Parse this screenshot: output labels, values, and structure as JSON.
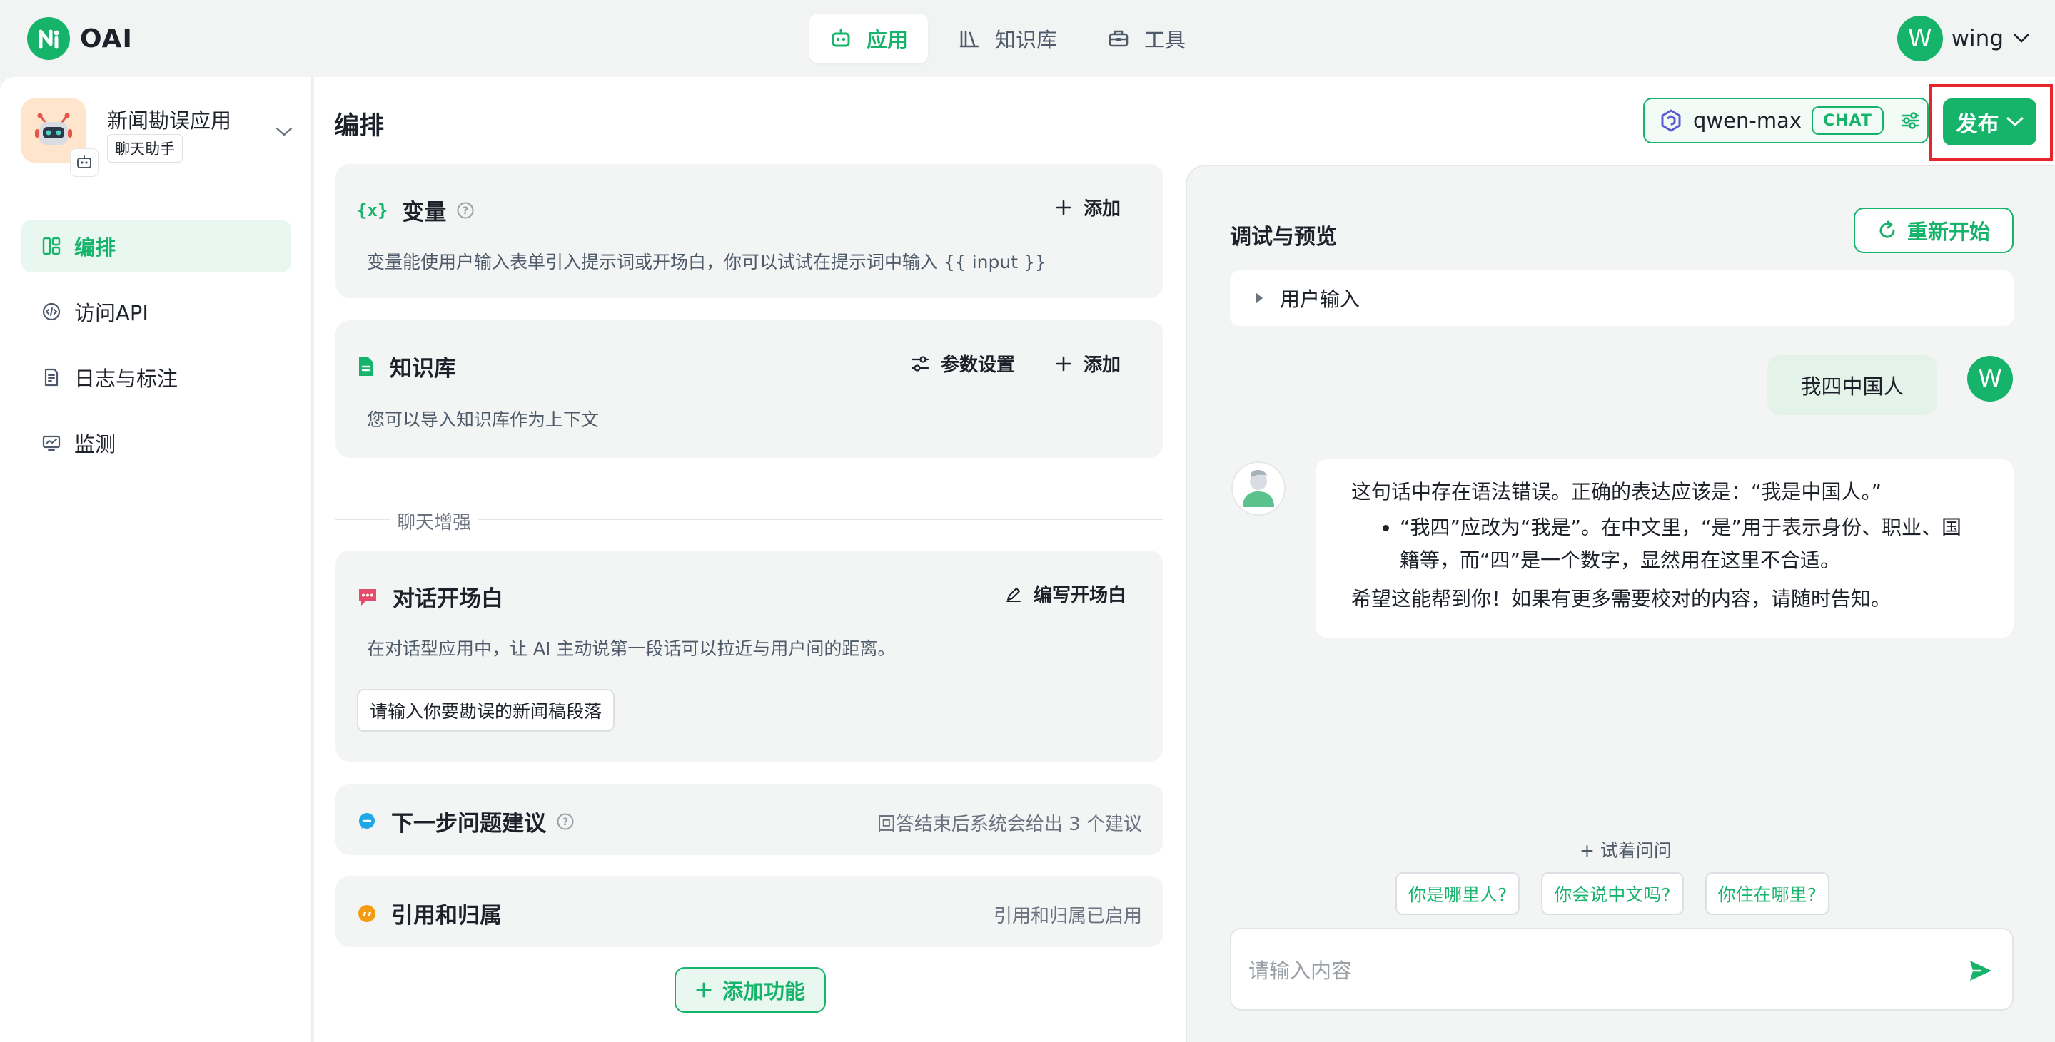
{
  "brand": {
    "name": "OAI"
  },
  "nav": {
    "items": [
      {
        "label": "应用",
        "icon": "robot-icon",
        "active": true
      },
      {
        "label": "知识库",
        "icon": "library-icon",
        "active": false
      },
      {
        "label": "工具",
        "icon": "toolbox-icon",
        "active": false
      }
    ]
  },
  "user": {
    "initial": "W",
    "name": "wing"
  },
  "app": {
    "name": "新闻勘误应用",
    "type": "聊天助手"
  },
  "sidebar": {
    "items": [
      {
        "label": "编排",
        "icon": "layout-icon",
        "active": true
      },
      {
        "label": "访问API",
        "icon": "api-icon",
        "active": false
      },
      {
        "label": "日志与标注",
        "icon": "log-icon",
        "active": false
      },
      {
        "label": "监测",
        "icon": "monitor-icon",
        "active": false
      }
    ]
  },
  "main": {
    "title": "编排"
  },
  "model": {
    "name": "qwen-max",
    "tag": "CHAT"
  },
  "publish": {
    "label": "发布"
  },
  "variables": {
    "title": "变量",
    "icon_text": "{x}",
    "add": "添加",
    "desc": "变量能使用户输入表单引入提示词或开场白，你可以试试在提示词中输入 {{ input }}"
  },
  "knowledge": {
    "title": "知识库",
    "params": "参数设置",
    "add": "添加",
    "desc": "您可以导入知识库作为上下文"
  },
  "enhance": {
    "label": "聊天增强"
  },
  "opener": {
    "title": "对话开场白",
    "edit": "编写开场白",
    "desc": "在对话型应用中，让 AI 主动说第一段话可以拉近与用户间的距离。",
    "chip": "请输入你要勘误的新闻稿段落"
  },
  "next_suggest": {
    "title": "下一步问题建议",
    "status": "回答结束后系统会给出 3 个建议"
  },
  "citation": {
    "title": "引用和归属",
    "status": "引用和归属已启用"
  },
  "add_feature": {
    "label": "添加功能"
  },
  "preview": {
    "title": "调试与预览",
    "restart": "重新开始",
    "user_input": "用户输入",
    "user_initial": "W",
    "user_message": "我四中国人",
    "ai_line1": "这句话中存在语法错误。正确的表达应该是：“我是中国人。”",
    "ai_bullet": "“我四”应改为“我是”。在中文里，“是”用于表示身份、职业、国籍等，而“四”是一个数字，显然用在这里不合适。",
    "ai_line3": "希望这能帮到你！如果有更多需要校对的内容，请随时告知。",
    "try_ask": "+ 试着问问",
    "suggestions": [
      "你是哪里人?",
      "你会说中文吗?",
      "你住在哪里?"
    ],
    "input_placeholder": "请输入内容"
  },
  "colors": {
    "accent": "#16b36b",
    "highlight_border": "#e8252a"
  }
}
